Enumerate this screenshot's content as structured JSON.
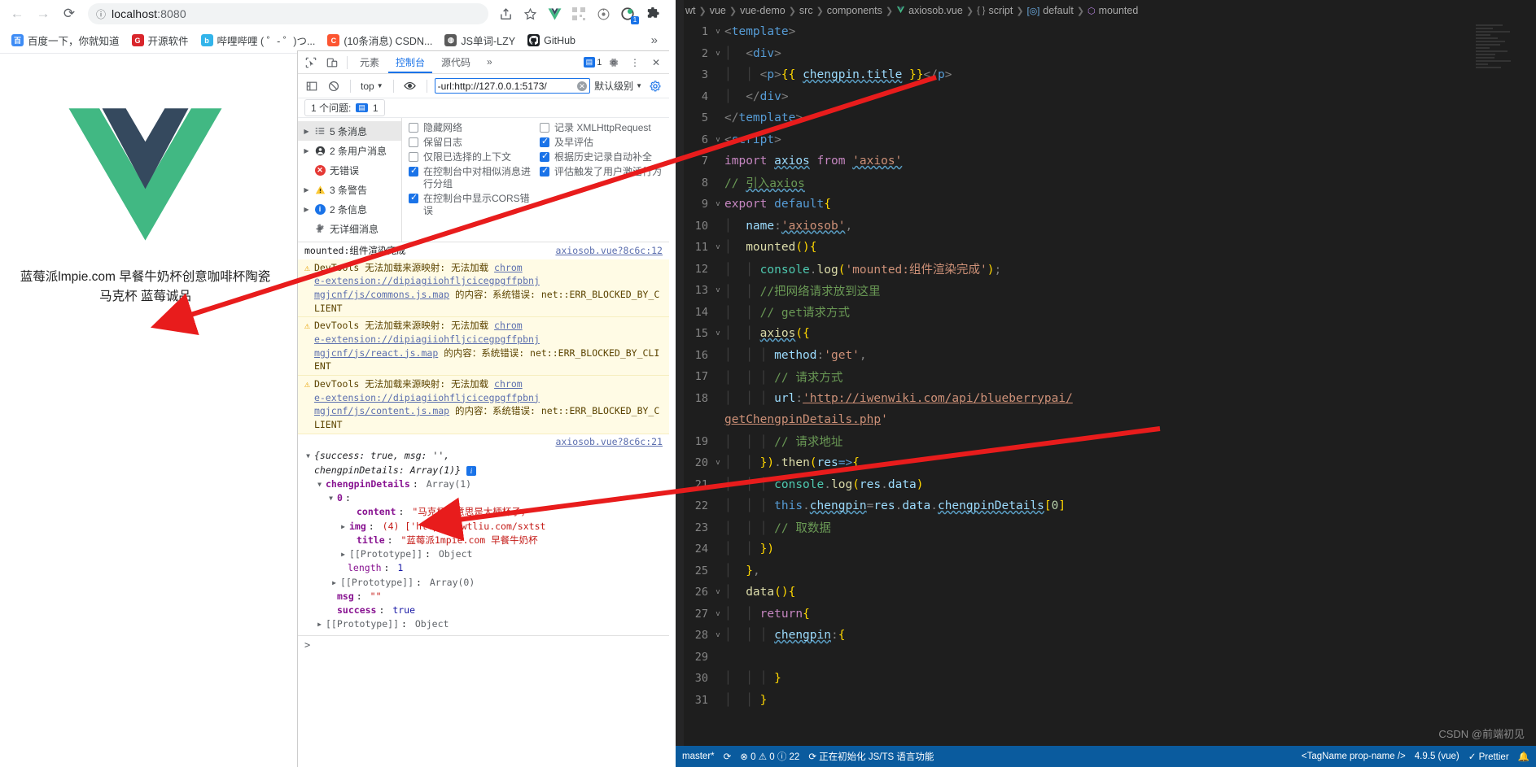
{
  "browser": {
    "nav": {
      "back": "←",
      "forward": "→",
      "reload": "⟳"
    },
    "url": {
      "host": "localhost",
      "port": ":8080",
      "info_icon": "info-icon"
    },
    "right_icons": [
      "share-icon",
      "star-icon",
      "vue-devtools-icon",
      "qr-icon",
      "clock-icon",
      "extension-badge-icon",
      "puzzle-icon"
    ],
    "extension_badge_count": "1",
    "bookmarks": [
      {
        "label": "百度一下，你就知道",
        "letter": "百",
        "color": "#3e8cf5"
      },
      {
        "label": "开源软件",
        "letter": "G",
        "color": "#d9262c"
      },
      {
        "label": "哔哩哔哩 ( ゜- ゜)つ...",
        "letter": "b",
        "color": "#32b4ea"
      },
      {
        "label": "(10条消息) CSDN...",
        "letter": "C",
        "color": "#fc5531"
      },
      {
        "label": "JS单词-LZY",
        "letter": "◍",
        "color": "#5a5a5a"
      },
      {
        "label": "GitHub",
        "letter": "",
        "color": "#1b1f23"
      }
    ],
    "bookmarks_overflow": "»"
  },
  "page": {
    "product_text": "蓝莓派lmpie.com 早餐牛奶杯创意咖啡杯陶瓷马克杯 蓝莓诚品",
    "logo": "vue-logo"
  },
  "devtools": {
    "tabs": [
      {
        "label": "元素",
        "active": false
      },
      {
        "label": "控制台",
        "active": true
      },
      {
        "label": "源代码",
        "active": false
      }
    ],
    "tabs_overflow": "»",
    "icons": {
      "inspect": "inspect-icon",
      "device": "device-toolbar-icon",
      "settings": "gear-icon",
      "more": "kebab-menu-icon",
      "close": "close-icon",
      "message": "message-icon"
    },
    "issue_count_badge": "1",
    "toolbar": {
      "sidebar_toggle": "sidebar-toggle-icon",
      "clear": "clear-console-icon",
      "context": "top",
      "eye": "eye-icon",
      "filter_value": "-url:http://127.0.0.1:5173/",
      "level": "默认级别"
    },
    "issues_label": "1 个问题:",
    "issues_count": "1",
    "sidebar": [
      {
        "label": "5 条消息",
        "tri": true,
        "icon": "list-icon",
        "selected": true
      },
      {
        "label": "2 条用户消息",
        "tri": true,
        "icon": "user-icon",
        "selected": false
      },
      {
        "label": "无错误",
        "tri": false,
        "icon": "error-icon",
        "selected": false
      },
      {
        "label": "3 条警告",
        "tri": true,
        "icon": "warning-icon",
        "selected": false
      },
      {
        "label": "2 条信息",
        "tri": true,
        "icon": "info-icon",
        "selected": false
      },
      {
        "label": "无详细消息",
        "tri": false,
        "icon": "verbose-icon",
        "selected": false
      }
    ],
    "settings_left": [
      {
        "label": "隐藏网络",
        "checked": false
      },
      {
        "label": "保留日志",
        "checked": false
      },
      {
        "label": "仅限已选择的上下文",
        "checked": false
      },
      {
        "label": "在控制台中对相似消息进行分组",
        "checked": true
      },
      {
        "label": "在控制台中显示CORS错误",
        "checked": true
      }
    ],
    "settings_right": [
      {
        "label": "记录 XMLHttpRequest",
        "checked": false
      },
      {
        "label": "及早评估",
        "checked": true
      },
      {
        "label": "根据历史记录自动补全",
        "checked": true
      },
      {
        "label": "评估触发了用户激活行为",
        "checked": true
      }
    ],
    "console": {
      "log_line": {
        "text": "mounted:组件渲染完成",
        "source": "axiosob.vue?8c6c:12"
      },
      "warnings": [
        {
          "head": "DevTools 无法加载来源映射: 无法加载",
          "link_head": "chrom",
          "link_lines": [
            "e-extension://dipiagiiohfljcicegpgffpbnj",
            "mgjcnf/js/commons.js.map"
          ],
          "tail": " 的内容：系统错误: net::ERR_BLOCKED_BY_CLIENT"
        },
        {
          "head": "DevTools 无法加载来源映射: 无法加载",
          "link_head": "chrom",
          "link_lines": [
            "e-extension://dipiagiiohfljcicegpgffpbnj",
            "mgjcnf/js/react.js.map"
          ],
          "tail": " 的内容：系统错误: net::ERR_BLOCKED_BY_CLIENT"
        },
        {
          "head": "DevTools 无法加载来源映射: 无法加载",
          "link_head": "chrom",
          "link_lines": [
            "e-extension://dipiagiiohfljcicegpgffpbnj",
            "mgjcnf/js/content.js.map"
          ],
          "tail": " 的内容：系统错误: net::ERR_BLOCKED_BY_CLIENT"
        }
      ],
      "object_source": "axiosob.vue?8c6c:21",
      "object_summary": "{success: true, msg: '', chengpinDetails: Array(1)}",
      "tree": [
        {
          "depth": 1,
          "tri": "d",
          "key": "chengpinDetails",
          "sep": ": ",
          "val": "Array(1)",
          "keyclass": "k-purple",
          "valclass": "k-grey"
        },
        {
          "depth": 2,
          "tri": "d",
          "key": "0",
          "sep": ":",
          "val": "",
          "keyclass": "k-purple",
          "valclass": ""
        },
        {
          "depth": 3,
          "tri": "",
          "key": "content",
          "sep": ": ",
          "val": "\"马克杯的意思是大柄杯子，",
          "keyclass": "k-purple",
          "valclass": "k-red"
        },
        {
          "depth": 3,
          "tri": "r",
          "key": "img",
          "sep": ": ",
          "val": "(4) ['http://wwtliu.com/sxtst",
          "keyclass": "k-purple",
          "valclass": "k-red"
        },
        {
          "depth": 3,
          "tri": "",
          "key": "title",
          "sep": ": ",
          "val": "\"蓝莓派1mpie.com 早餐牛奶杯",
          "keyclass": "k-purple",
          "valclass": "k-red"
        },
        {
          "depth": 3,
          "tri": "r",
          "key": "[[Prototype]]",
          "sep": ": ",
          "val": "Object",
          "keyclass": "k-grey",
          "valclass": "k-grey"
        },
        {
          "depth": 2,
          "tri": "",
          "key": "length",
          "sep": ": ",
          "val": "1",
          "keyclass": "k-purple",
          "valclass": "k-blue"
        },
        {
          "depth": 2,
          "tri": "r",
          "key": "[[Prototype]]",
          "sep": ": ",
          "val": "Array(0)",
          "keyclass": "k-grey",
          "valclass": "k-grey"
        },
        {
          "depth": 1,
          "tri": "",
          "key": "msg",
          "sep": ": ",
          "val": "\"\"",
          "keyclass": "k-purple",
          "valclass": "k-red"
        },
        {
          "depth": 1,
          "tri": "",
          "key": "success",
          "sep": ": ",
          "val": "true",
          "keyclass": "k-purple",
          "valclass": "k-blue"
        },
        {
          "depth": 0,
          "tri": "r",
          "key": "[[Prototype]]",
          "sep": ": ",
          "val": "Object",
          "keyclass": "k-grey",
          "valclass": "k-grey"
        }
      ],
      "prompt": ">"
    }
  },
  "vscode": {
    "breadcrumb": [
      {
        "label": "wt",
        "icon": ""
      },
      {
        "label": "vue",
        "icon": ""
      },
      {
        "label": "vue-demo",
        "icon": ""
      },
      {
        "label": "src",
        "icon": ""
      },
      {
        "label": "components",
        "icon": ""
      },
      {
        "label": "axiosob.vue",
        "icon": "vue-file-icon"
      },
      {
        "label": "script",
        "icon": "braces-icon"
      },
      {
        "label": "default",
        "icon": "object-icon"
      },
      {
        "label": "mounted",
        "icon": "method-icon"
      }
    ],
    "lines": [
      {
        "n": 1,
        "fold": "v"
      },
      {
        "n": 2,
        "fold": "v"
      },
      {
        "n": 3,
        "fold": ""
      },
      {
        "n": 4,
        "fold": ""
      },
      {
        "n": 5,
        "fold": ""
      },
      {
        "n": 6,
        "fold": "v"
      },
      {
        "n": 7,
        "fold": ""
      },
      {
        "n": 8,
        "fold": ""
      },
      {
        "n": 9,
        "fold": "v"
      },
      {
        "n": 10,
        "fold": ""
      },
      {
        "n": 11,
        "fold": "v"
      },
      {
        "n": 12,
        "fold": ""
      },
      {
        "n": 13,
        "fold": "v"
      },
      {
        "n": 14,
        "fold": ""
      },
      {
        "n": 15,
        "fold": "v"
      },
      {
        "n": 16,
        "fold": ""
      },
      {
        "n": 17,
        "fold": ""
      },
      {
        "n": 18,
        "fold": ""
      },
      {
        "n": 19,
        "fold": ""
      },
      {
        "n": 20,
        "fold": "v"
      },
      {
        "n": 21,
        "fold": ""
      },
      {
        "n": 22,
        "fold": ""
      },
      {
        "n": 23,
        "fold": ""
      },
      {
        "n": 24,
        "fold": ""
      },
      {
        "n": 25,
        "fold": ""
      },
      {
        "n": 26,
        "fold": "v"
      },
      {
        "n": 27,
        "fold": "v"
      },
      {
        "n": 28,
        "fold": "v"
      },
      {
        "n": 29,
        "fold": ""
      },
      {
        "n": 30,
        "fold": ""
      },
      {
        "n": 31,
        "fold": ""
      }
    ],
    "code_text": [
      "<template>",
      "  <div>",
      "    <p>{{ chengpin.title }}</p>",
      "  </div>",
      "</template>",
      "<script>",
      "import axios from 'axios'",
      "// 引入axios",
      "export default{",
      "  name:'axiosob',",
      "  mounted(){",
      "    console.log('mounted:组件渲染完成');",
      "    //把网络请求放到这里",
      "    // get请求方式",
      "    axios({",
      "      method:'get',",
      "      // 请求方式",
      "      url:'http://iwenwiki.com/api/blueberrypai/",
      "getChengpinDetails.php'",
      "      // 请求地址",
      "    }).then(res=>{",
      "      console.log(res.data)",
      "      this.chengpin=res.data.chengpinDetails[0]",
      "      // 取数据",
      "    })",
      "  },",
      "  data(){",
      "    return{",
      "      chengpin:{",
      "",
      "      }",
      "    }"
    ],
    "status": {
      "branch": "master*",
      "sync": "sync-icon",
      "errors": "0",
      "warnings": "0",
      "infos": "22",
      "task": "正在初始化 JS/TS 语言功能",
      "tag": "<TagName prop-name />",
      "version": "4.9.5 (vue)",
      "prettier": "Prettier",
      "bell": "bell-icon"
    },
    "watermark": "CSDN @前端初见"
  }
}
